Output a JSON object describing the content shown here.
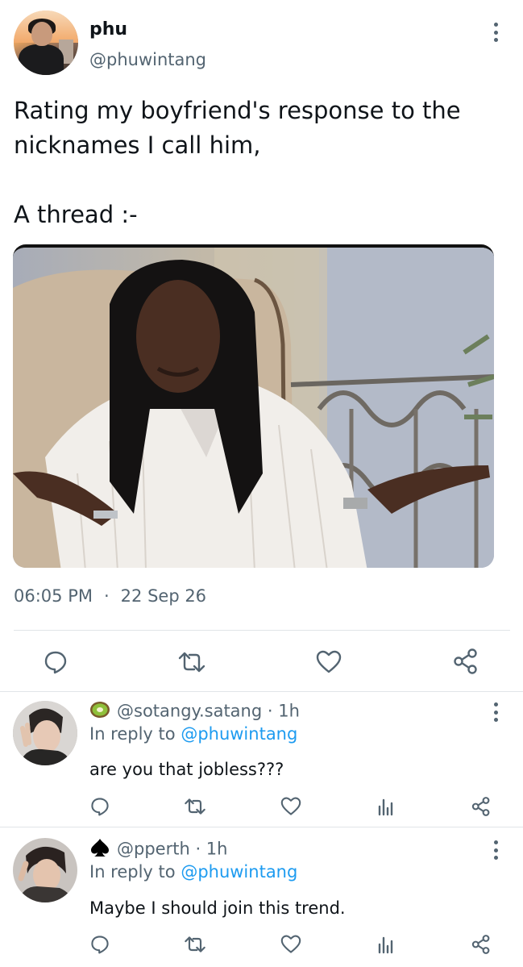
{
  "main_tweet": {
    "display_name": "phu",
    "handle": "@phuwintang",
    "text_line1": "Rating my boyfriend's response to the",
    "text_line2": "nicknames I call him,",
    "text_line3": "A thread :-",
    "time": "06:05 PM",
    "separator": "·",
    "date": "22 Sep 26",
    "actions": [
      "reply-icon",
      "retweet-icon",
      "like-icon",
      "share-icon"
    ]
  },
  "replies": [
    {
      "badge_icon": "kiwi-icon",
      "handle": "@sotangy.satang",
      "meta": "· 1h",
      "in_reply_prefix": "In reply to",
      "in_reply_handle": "@phuwintang",
      "text": "are you that jobless???",
      "actions": [
        "reply-icon",
        "retweet-icon",
        "like-icon",
        "views-icon",
        "share-icon"
      ]
    },
    {
      "badge_icon": "spade-icon",
      "handle": "@pperth",
      "meta": "· 1h",
      "in_reply_prefix": "In reply to",
      "in_reply_handle": "@phuwintang",
      "text": "Maybe I should join this trend.",
      "actions": [
        "reply-icon",
        "retweet-icon",
        "like-icon",
        "views-icon",
        "share-icon"
      ]
    }
  ],
  "colors": {
    "text": "#0f1419",
    "secondary": "#536471",
    "link": "#1d9bf0",
    "divider": "#e1e5e8",
    "icon": "#536471"
  }
}
